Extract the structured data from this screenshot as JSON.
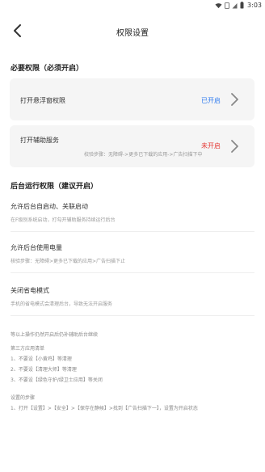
{
  "statusbar": {
    "time": "3:03",
    "icons": [
      "wifi-icon",
      "sim-icon",
      "signal-icon",
      "battery-icon"
    ]
  },
  "navbar": {
    "title": "权限设置"
  },
  "required": {
    "section_title": "必要权限（必须开启）",
    "floating": {
      "label": "打开悬浮窗权限",
      "status": "已开启",
      "status_color": "#2f7bef"
    },
    "accessibility": {
      "label": "打开辅助服务",
      "status": "未开启",
      "status_color": "#e53935",
      "hint": "校验步骤：无障碍->更多已下载的应用->广告扫描下中"
    }
  },
  "background": {
    "section_title": "后台运行权限（建议开启）",
    "items": [
      {
        "title": "允许后台自启动、关联启动",
        "desc": "在F级别系统启动，打勾开辅助服务持续运行后台"
      },
      {
        "title": "允许后台使用电量",
        "desc": "核验步骤：无障碍>更多已下载的应用>广告扫描下止"
      },
      {
        "title": "关闭省电模式",
        "desc": "手机的省电模式会清理后台，导致无法开启服务"
      }
    ]
  },
  "notes": {
    "intro": "等以上操作仍然开启后仍补辅助后台继续",
    "third_party_title": "第三方应用清单",
    "third_party": [
      "1、不要设【小黄鸡】等清理",
      "2、不要设【清理大师】等清理",
      "3、不要设【绿色守护/绿卫士应用】等关闭"
    ],
    "settings_title": "设置的步骤",
    "settings_step": "1、打开【设置】>【安全】>【保存在静候】>找到【广告扫描下一】，设置为开启状态"
  }
}
